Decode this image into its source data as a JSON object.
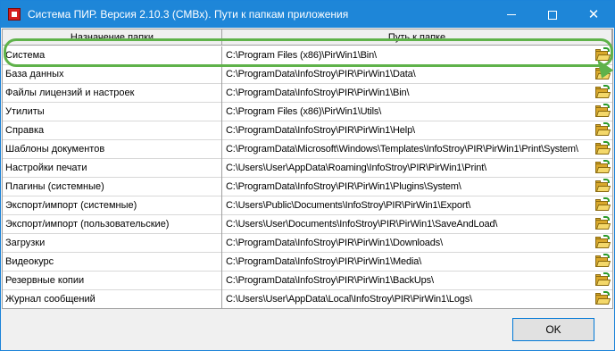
{
  "window": {
    "title": "Система ПИР. Версия 2.10.3  (СМВх). Пути к папкам приложения"
  },
  "colors": {
    "titlebar": "#1e86d8",
    "highlight": "#5fb24a",
    "folder": "#d9a82b"
  },
  "grid": {
    "headers": {
      "name": "Назначение папки",
      "path": "Путь к папке"
    },
    "rows": [
      {
        "name": "Система",
        "path": "C:\\Program Files (x86)\\PirWin1\\Bin\\",
        "icon": "folder-open-icon"
      },
      {
        "name": "База данных",
        "path": "C:\\ProgramData\\InfoStroy\\PIR\\PirWin1\\Data\\",
        "icon": "folder-open-icon"
      },
      {
        "name": "Файлы лицензий и настроек",
        "path": "C:\\ProgramData\\InfoStroy\\PIR\\PirWin1\\Bin\\",
        "icon": "folder-open-icon"
      },
      {
        "name": "Утилиты",
        "path": "C:\\Program Files (x86)\\PirWin1\\Utils\\",
        "icon": "folder-open-icon"
      },
      {
        "name": "Справка",
        "path": "C:\\ProgramData\\InfoStroy\\PIR\\PirWin1\\Help\\",
        "icon": "folder-open-icon"
      },
      {
        "name": "Шаблоны документов",
        "path": "C:\\ProgramData\\Microsoft\\Windows\\Templates\\InfoStroy\\PIR\\PirWin1\\Print\\System\\",
        "icon": "folder-open-icon"
      },
      {
        "name": "Настройки печати",
        "path": "C:\\Users\\User\\AppData\\Roaming\\InfoStroy\\PIR\\PirWin1\\Print\\",
        "icon": "folder-open-icon"
      },
      {
        "name": "Плагины (системные)",
        "path": "C:\\ProgramData\\InfoStroy\\PIR\\PirWin1\\Plugins\\System\\",
        "icon": "folder-open-icon"
      },
      {
        "name": "Экспорт/импорт (системные)",
        "path": "C:\\Users\\Public\\Documents\\InfoStroy\\PIR\\PirWin1\\Export\\",
        "icon": "folder-open-icon"
      },
      {
        "name": "Экспорт/импорт (пользовательские)",
        "path": "C:\\Users\\User\\Documents\\InfoStroy\\PIR\\PirWin1\\SaveAndLoad\\",
        "icon": "folder-open-icon"
      },
      {
        "name": "Загрузки",
        "path": "C:\\ProgramData\\InfoStroy\\PIR\\PirWin1\\Downloads\\",
        "icon": "folder-open-icon"
      },
      {
        "name": "Видеокурс",
        "path": "C:\\ProgramData\\InfoStroy\\PIR\\PirWin1\\Media\\",
        "icon": "folder-open-icon"
      },
      {
        "name": "Резервные копии",
        "path": "C:\\ProgramData\\InfoStroy\\PIR\\PirWin1\\BackUps\\",
        "icon": "folder-open-icon"
      },
      {
        "name": "Журнал сообщений",
        "path": "C:\\Users\\User\\AppData\\Local\\InfoStroy\\PIR\\PirWin1\\Logs\\",
        "icon": "folder-open-icon"
      }
    ]
  },
  "buttons": {
    "ok": "OK"
  }
}
